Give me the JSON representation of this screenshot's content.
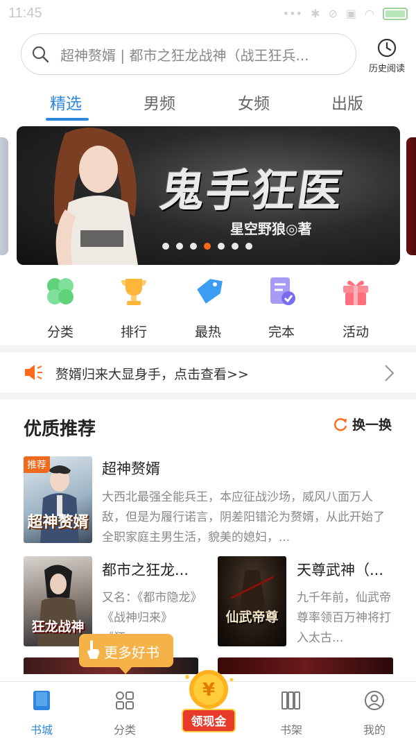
{
  "status_bar": {
    "time": "11:45"
  },
  "search": {
    "placeholder": "超神赘婿 | 都市之狂龙战神（战王狂兵..."
  },
  "history": {
    "label": "历史阅读"
  },
  "tabs": [
    {
      "label": "精选",
      "active": true
    },
    {
      "label": "男频",
      "active": false
    },
    {
      "label": "女频",
      "active": false
    },
    {
      "label": "出版",
      "active": false
    }
  ],
  "banner": {
    "title": "鬼手狂医",
    "author": "星空野狼◎著",
    "total_dots": 7,
    "active_dot": 4
  },
  "quick_nav": [
    {
      "label": "分类",
      "icon": "clover-icon",
      "color": "#5fd27a"
    },
    {
      "label": "排行",
      "icon": "trophy-icon",
      "color": "#ffb43a"
    },
    {
      "label": "最热",
      "icon": "tag-icon",
      "color": "#3a9cf2"
    },
    {
      "label": "完本",
      "icon": "document-check-icon",
      "color": "#8a7cf0"
    },
    {
      "label": "活动",
      "icon": "gift-icon",
      "color": "#ff6f7d"
    }
  ],
  "notice": {
    "text": "赘婿归来大显身手，点击查看>>"
  },
  "recommend": {
    "title": "优质推荐",
    "refresh_label": "换一换",
    "featured": {
      "tag": "推荐",
      "title": "超神赘婿",
      "cover_text": "超神赘婿",
      "description": "大西北最强全能兵王，本应征战沙场，威风八面万人敌，但是为履行诺言，阴差阳错沦为赘婿，从此开始了全职家庭主男生活，貌美的媳妇，..."
    },
    "books": [
      {
        "title": "都市之狂龙...",
        "cover_text": "狂龙战神",
        "description": "又名：《都市隐龙》《战神归来》《狂..."
      },
      {
        "title": "天尊武神（...",
        "cover_text": "仙武帝尊",
        "description": "九千年前，仙武帝尊率领百万神将打入太古..."
      }
    ]
  },
  "more_books": {
    "label": "更多好书"
  },
  "bottom_nav": [
    {
      "label": "书城",
      "icon": "book-icon",
      "active": true
    },
    {
      "label": "分类",
      "icon": "grid-icon",
      "active": false
    },
    {
      "label": "领现金",
      "icon": "coin-icon",
      "active": false
    },
    {
      "label": "书架",
      "icon": "bookshelf-icon",
      "active": false
    },
    {
      "label": "我的",
      "icon": "profile-icon",
      "active": false
    }
  ],
  "colors": {
    "accent": "#2e86de",
    "highlight": "#ff6a1a"
  }
}
